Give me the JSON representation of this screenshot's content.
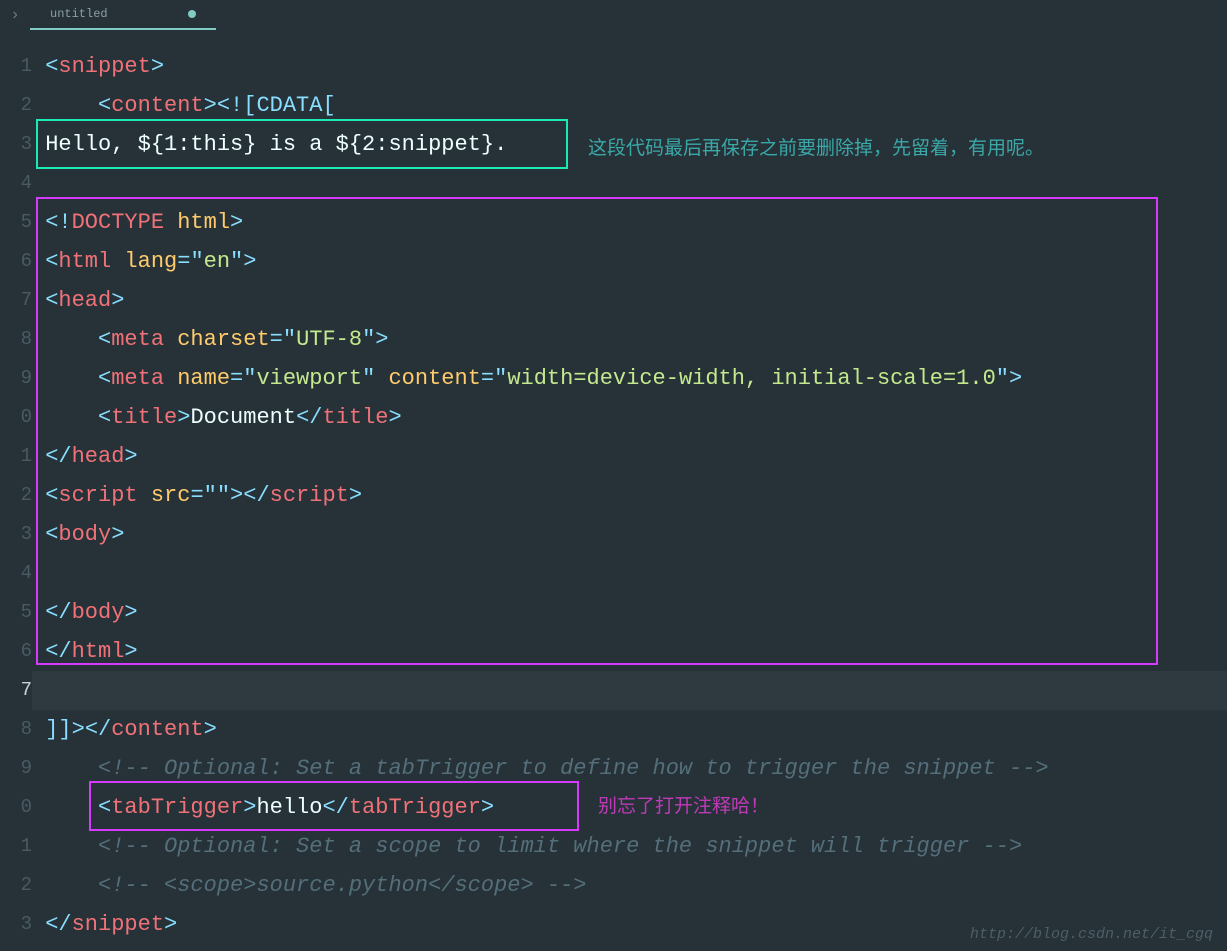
{
  "tab": {
    "title": "untitled"
  },
  "gutter": [
    "1",
    "2",
    "3",
    "4",
    "5",
    "6",
    "7",
    "8",
    "9",
    "0",
    "1",
    "2",
    "3",
    "4",
    "5",
    "6",
    "7",
    "8",
    "9",
    "0",
    "1",
    "2",
    "3"
  ],
  "code": {
    "l1": {
      "p1": "<",
      "tag1": "snippet",
      "p2": ">"
    },
    "l2": {
      "pad": "    ",
      "p1": "<",
      "tag1": "content",
      "p2": ">",
      "cdata": "<![CDATA["
    },
    "l3": {
      "text": "Hello, ${1:this} is a ${2:snippet}."
    },
    "l5": {
      "p1": "<!",
      "tag": "DOCTYPE",
      "sp": " ",
      "attr": "html",
      "p2": ">"
    },
    "l6": {
      "p1": "<",
      "tag": "html",
      "sp": " ",
      "attr": "lang",
      "eq": "=",
      "q1": "\"",
      "val": "en",
      "q2": "\"",
      "p2": ">"
    },
    "l7": {
      "p1": "<",
      "tag": "head",
      "p2": ">"
    },
    "l8": {
      "pad": "    ",
      "p1": "<",
      "tag": "meta",
      "sp": " ",
      "attr": "charset",
      "eq": "=",
      "q1": "\"",
      "val": "UTF-8",
      "q2": "\"",
      "p2": ">"
    },
    "l9": {
      "pad": "    ",
      "p1": "<",
      "tag": "meta",
      "sp": " ",
      "attr1": "name",
      "eq1": "=",
      "q1": "\"",
      "val1": "viewport",
      "q2": "\"",
      "sp2": " ",
      "attr2": "content",
      "eq2": "=",
      "q3": "\"",
      "val2": "width=device-width, initial-scale=1.0",
      "q4": "\"",
      "p2": ">"
    },
    "l10": {
      "pad": "    ",
      "p1": "<",
      "tag": "title",
      "p2": ">",
      "text": "Document",
      "p3": "</",
      "tag2": "title",
      "p4": ">"
    },
    "l11": {
      "p1": "</",
      "tag": "head",
      "p2": ">"
    },
    "l12": {
      "p1": "<",
      "tag": "script",
      "sp": " ",
      "attr": "src",
      "eq": "=",
      "q1": "\"",
      "val": "",
      "q2": "\"",
      "p2": ">",
      "p3": "</",
      "tag2": "script",
      "p4": ">"
    },
    "l13": {
      "p1": "<",
      "tag": "body",
      "p2": ">"
    },
    "l15": {
      "p1": "</",
      "tag": "body",
      "p2": ">"
    },
    "l16": {
      "p1": "</",
      "tag": "html",
      "p2": ">"
    },
    "l18": {
      "cdata": "]]>",
      "p1": "</",
      "tag": "content",
      "p2": ">"
    },
    "l19": {
      "pad": "    ",
      "comment": "<!-- Optional: Set a tabTrigger to define how to trigger the snippet -->"
    },
    "l20": {
      "pad": "    ",
      "p1": "<",
      "tag": "tabTrigger",
      "p2": ">",
      "text": "hello",
      "p3": "</",
      "tag2": "tabTrigger",
      "p4": ">"
    },
    "l21": {
      "pad": "    ",
      "comment": "<!-- Optional: Set a scope to limit where the snippet will trigger -->"
    },
    "l22": {
      "pad": "    ",
      "comment": "<!-- <scope>source.python</scope> -->"
    },
    "l23": {
      "p1": "</",
      "tag": "snippet",
      "p2": ">"
    }
  },
  "annotations": {
    "a1": "这段代码最后再保存之前要删除掉，先留着，有用呢。",
    "a2": "别忘了打开注释哈！"
  },
  "watermark": "http://blog.csdn.net/it_cgq"
}
